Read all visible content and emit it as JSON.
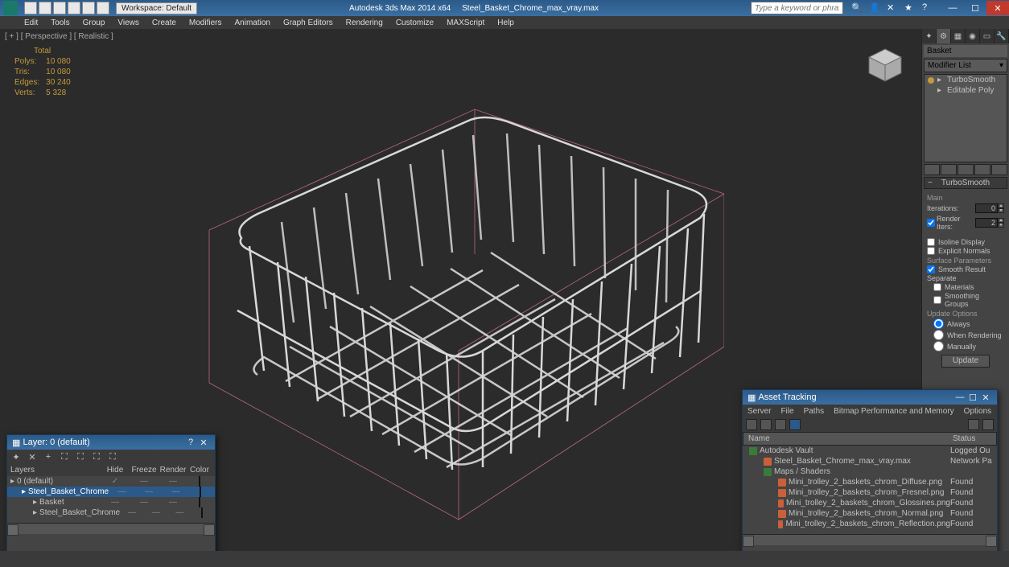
{
  "titlebar": {
    "workspace_label": "Workspace: Default",
    "app_title": "Autodesk 3ds Max  2014 x64",
    "file_name": "Steel_Basket_Chrome_max_vray.max",
    "search_placeholder": "Type a keyword or phrase"
  },
  "menubar": [
    "Edit",
    "Tools",
    "Group",
    "Views",
    "Create",
    "Modifiers",
    "Animation",
    "Graph Editors",
    "Rendering",
    "Customize",
    "MAXScript",
    "Help"
  ],
  "viewport": {
    "label": "[ + ] [ Perspective ] [ Realistic ]",
    "stats": {
      "header": "Total",
      "rows": [
        {
          "k": "Polys:",
          "v": "10 080"
        },
        {
          "k": "Tris:",
          "v": "10 080"
        },
        {
          "k": "Edges:",
          "v": "30 240"
        },
        {
          "k": "Verts:",
          "v": "5 328"
        }
      ]
    }
  },
  "cmdpanel": {
    "object_name": "Basket",
    "modifier_list_label": "Modifier List",
    "stack": [
      {
        "name": "TurboSmooth",
        "bulb": true
      },
      {
        "name": "Editable Poly",
        "bulb": false
      }
    ],
    "rollout_title": "TurboSmooth",
    "main_label": "Main",
    "iterations_label": "Iterations:",
    "iterations_value": "0",
    "render_iters_label": "Render Iters:",
    "render_iters_value": "2",
    "render_iters_checked": true,
    "isoline_label": "Isoline Display",
    "explicit_label": "Explicit Normals",
    "surface_label": "Surface Parameters",
    "smooth_result_label": "Smooth Result",
    "separate_label": "Separate",
    "materials_label": "Materials",
    "smoothing_groups_label": "Smoothing Groups",
    "update_options_label": "Update Options",
    "update_always": "Always",
    "update_rendering": "When Rendering",
    "update_manually": "Manually",
    "update_button": "Update"
  },
  "layer_dialog": {
    "title": "Layer: 0 (default)",
    "columns": {
      "layers": "Layers",
      "hide": "Hide",
      "freeze": "Freeze",
      "render": "Render",
      "color": "Color"
    },
    "rows": [
      {
        "indent": 0,
        "icon": "layer",
        "name": "0 (default)",
        "hide": "✓",
        "freeze": "—",
        "render": "—",
        "color": "#666",
        "sel": false
      },
      {
        "indent": 1,
        "icon": "obj",
        "name": "Steel_Basket_Chrome",
        "hide": "—",
        "freeze": "—",
        "render": "—",
        "color": "#cc3333",
        "sel": true
      },
      {
        "indent": 2,
        "icon": "obj",
        "name": "Basket",
        "hide": "—",
        "freeze": "—",
        "render": "—",
        "color": "#222",
        "sel": false
      },
      {
        "indent": 2,
        "icon": "obj",
        "name": "Steel_Basket_Chrome",
        "hide": "—",
        "freeze": "—",
        "render": "—",
        "color": "#222",
        "sel": false
      }
    ]
  },
  "asset_dialog": {
    "title": "Asset Tracking",
    "menu": [
      "Server",
      "File",
      "Paths",
      "Bitmap Performance and Memory",
      "Options"
    ],
    "columns": {
      "name": "Name",
      "status": "Status"
    },
    "rows": [
      {
        "indent": 0,
        "icon": "folder",
        "name": "Autodesk Vault",
        "status": "Logged Ou"
      },
      {
        "indent": 1,
        "icon": "file",
        "name": "Steel_Basket_Chrome_max_vray.max",
        "status": "Network Pa"
      },
      {
        "indent": 1,
        "icon": "folder",
        "name": "Maps / Shaders",
        "status": ""
      },
      {
        "indent": 2,
        "icon": "file",
        "name": "Mini_trolley_2_baskets_chrom_Diffuse.png",
        "status": "Found"
      },
      {
        "indent": 2,
        "icon": "file",
        "name": "Mini_trolley_2_baskets_chrom_Fresnel.png",
        "status": "Found"
      },
      {
        "indent": 2,
        "icon": "file",
        "name": "Mini_trolley_2_baskets_chrom_Glossines.png",
        "status": "Found"
      },
      {
        "indent": 2,
        "icon": "file",
        "name": "Mini_trolley_2_baskets_chrom_Normal.png",
        "status": "Found"
      },
      {
        "indent": 2,
        "icon": "file",
        "name": "Mini_trolley_2_baskets_chrom_Reflection.png",
        "status": "Found"
      }
    ]
  }
}
